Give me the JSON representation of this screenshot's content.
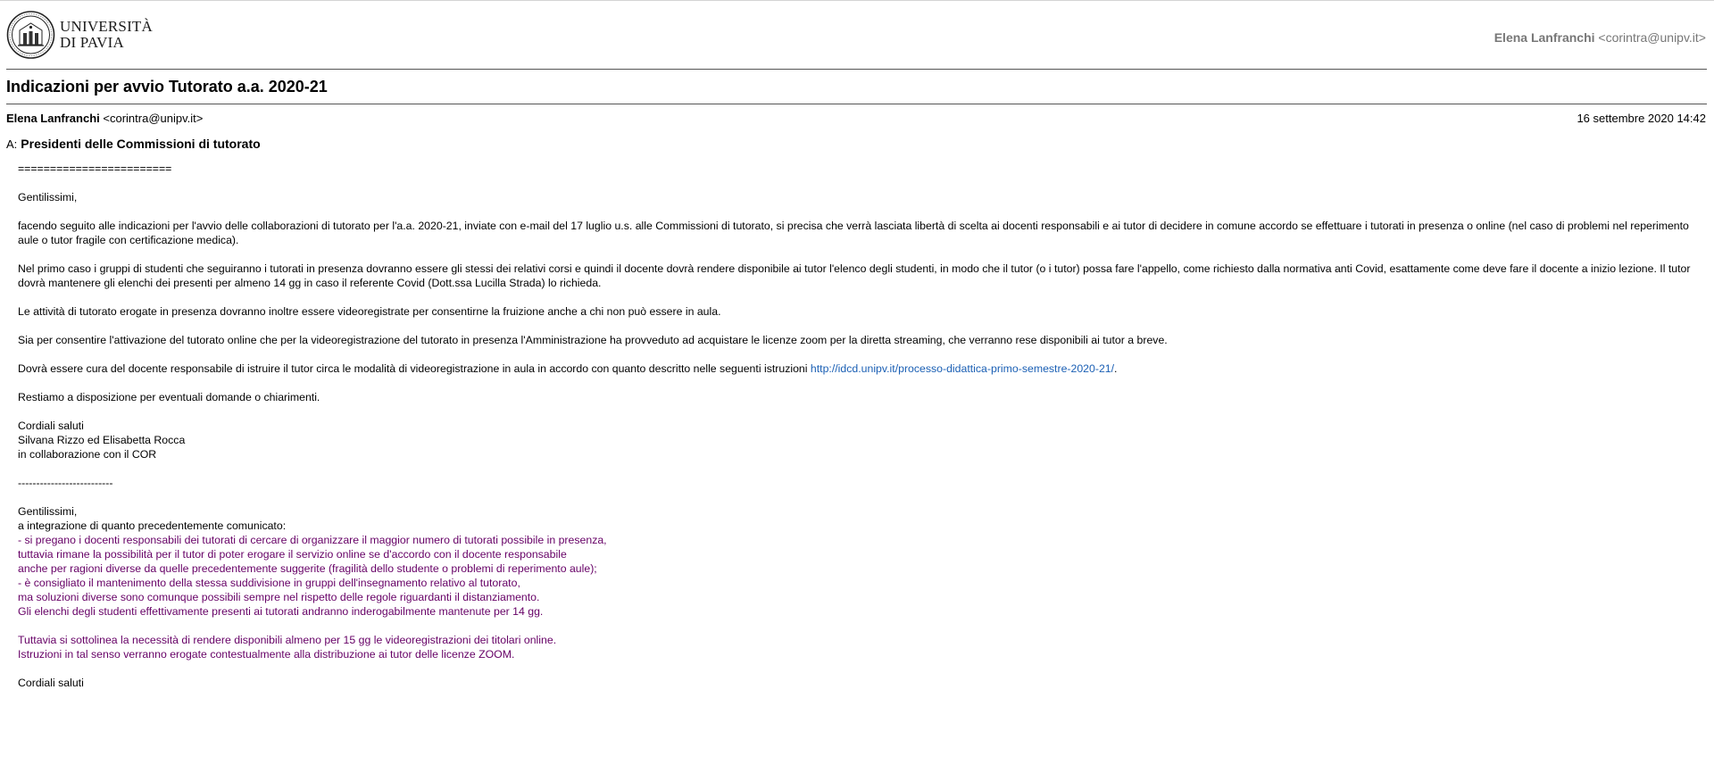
{
  "header": {
    "logo_line1": "UNIVERSITÀ",
    "logo_line2": "DI PAVIA",
    "user_name": "Elena Lanfranchi",
    "user_email": "<corintra@unipv.it>"
  },
  "message": {
    "subject": "Indicazioni per avvio Tutorato a.a. 2020-21",
    "from_name": "Elena Lanfranchi",
    "from_email": "<corintra@unipv.it>",
    "date": "16 settembre 2020 14:42",
    "to_label": "A:",
    "to_value": "Presidenti delle Commissioni di tutorato"
  },
  "body": {
    "separator": "========================",
    "greeting1": "Gentilissimi,",
    "para1": "facendo seguito alle indicazioni per l'avvio delle collaborazioni di tutorato per l'a.a. 2020-21, inviate con e-mail del 17 luglio u.s. alle Commissioni di tutorato, si precisa che verrà lasciata libertà di scelta ai docenti responsabili e ai tutor di decidere in comune accordo se effettuare i tutorati in presenza o online (nel caso di problemi nel reperimento aule o tutor fragile con certificazione medica).",
    "para2": "Nel primo caso i gruppi di studenti che seguiranno i tutorati in presenza dovranno essere gli stessi dei relativi corsi e quindi il docente dovrà rendere disponibile ai tutor l'elenco degli studenti, in modo che il tutor (o i tutor) possa fare l'appello, come richiesto dalla normativa anti Covid, esattamente come deve fare il docente a inizio lezione. Il tutor dovrà mantenere gli elenchi dei presenti per almeno 14 gg in caso il referente Covid (Dott.ssa Lucilla Strada) lo richieda.",
    "para3": "Le attività di tutorato erogate in presenza dovranno inoltre essere videoregistrate per consentirne la fruizione anche a chi non può essere in aula.",
    "para4": "Sia per consentire l'attivazione del tutorato online che per la videoregistrazione del tutorato in presenza l'Amministrazione ha provveduto ad acquistare le licenze zoom per la diretta streaming, che verranno rese disponibili ai tutor a breve.",
    "para5_text": "Dovrà essere cura del docente responsabile di istruire il tutor circa le modalità di videoregistrazione in aula in accordo con quanto descritto nelle seguenti istruzioni ",
    "para5_link": "http://idcd.unipv.it/processo-didattica-primo-semestre-2020-21/",
    "para5_end": ".",
    "para6": "Restiamo a disposizione per eventuali domande o chiarimenti.",
    "sign1": "Cordiali saluti",
    "sign2": "Silvana Rizzo ed Elisabetta Rocca",
    "sign3": "in collaborazione con il COR",
    "divider": "--------------------------",
    "greeting2": "Gentilissimi,",
    "intro2": "a integrazione di quanto precedentemente comunicato:",
    "purple_lines": [
      "- si pregano i docenti responsabili dei tutorati di cercare di organizzare il maggior numero di tutorati possibile in presenza,",
      "tuttavia rimane la possibilità per il tutor di poter erogare il servizio online se d'accordo con il docente responsabile",
      "anche per ragioni diverse da quelle precedentemente suggerite (fragilità dello studente o problemi di reperimento aule);",
      "- è consigliato il mantenimento della stessa suddivisione in gruppi dell'insegnamento relativo al tutorato,",
      "ma soluzioni diverse sono comunque possibili sempre nel rispetto delle regole riguardanti il distanziamento.",
      "Gli elenchi degli studenti effettivamente presenti ai tutorati andranno inderogabilmente mantenute per 14 gg."
    ],
    "purple_lines2": [
      "Tuttavia si sottolinea la necessità di rendere disponibili almeno per 15 gg le videoregistrazioni dei titolari online.",
      "Istruzioni in tal senso verranno erogate contestualmente alla distribuzione ai tutor delle licenze ZOOM."
    ],
    "closing": "Cordiali saluti"
  },
  "colors": {
    "link": "#1a5fb4",
    "purple": "#660066",
    "header_user": "#777777"
  }
}
